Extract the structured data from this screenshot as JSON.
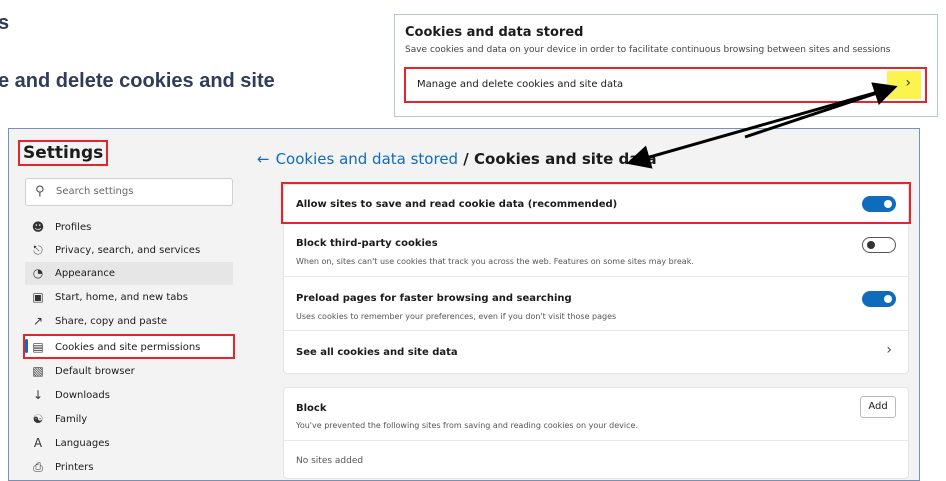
{
  "doc": {
    "fragment_top": "s",
    "fragment_line": "e and delete cookies and site"
  },
  "inset": {
    "title": "Cookies and data stored",
    "description": "Save cookies and data on your device in order to facilitate continuous browsing between sites and sessions",
    "row_label": "Manage and delete cookies and site data",
    "highlight_color": "#fbf44f"
  },
  "sidebar": {
    "title": "Settings",
    "search_placeholder": "Search settings",
    "items": [
      {
        "label": "Profiles",
        "icon": "profile-icon"
      },
      {
        "label": "Privacy, search, and services",
        "icon": "lock-icon"
      },
      {
        "label": "Appearance",
        "icon": "appearance-icon"
      },
      {
        "label": "Start, home, and new tabs",
        "icon": "start-icon"
      },
      {
        "label": "Share, copy and paste",
        "icon": "share-icon"
      },
      {
        "label": "Cookies and site permissions",
        "icon": "cookies-icon"
      },
      {
        "label": "Default browser",
        "icon": "browser-icon"
      },
      {
        "label": "Downloads",
        "icon": "download-icon"
      },
      {
        "label": "Family",
        "icon": "family-icon"
      },
      {
        "label": "Languages",
        "icon": "languages-icon"
      },
      {
        "label": "Printers",
        "icon": "printer-icon"
      }
    ]
  },
  "main": {
    "breadcrumb_parent": "Cookies and data stored",
    "breadcrumb_separator": " / ",
    "breadcrumb_current": "Cookies and site data",
    "settings": [
      {
        "title": "Allow sites to save and read cookie data (recommended)",
        "desc": "",
        "state": "on"
      },
      {
        "title": "Block third-party cookies",
        "desc": "When on, sites can't use cookies that track you across the web. Features on some sites may break.",
        "state": "off"
      },
      {
        "title": "Preload pages for faster browsing and searching",
        "desc": "Uses cookies to remember your preferences, even if you don't visit those pages",
        "state": "on"
      },
      {
        "title": "See all cookies and site data",
        "desc": "",
        "state": "link"
      }
    ],
    "block": {
      "title": "Block",
      "desc": "You've prevented the following sites from saving and reading cookies on your device.",
      "add_label": "Add",
      "empty_text": "No sites added"
    }
  },
  "colors": {
    "accent": "#0f6cbd",
    "annotation_red": "#e3262b"
  }
}
